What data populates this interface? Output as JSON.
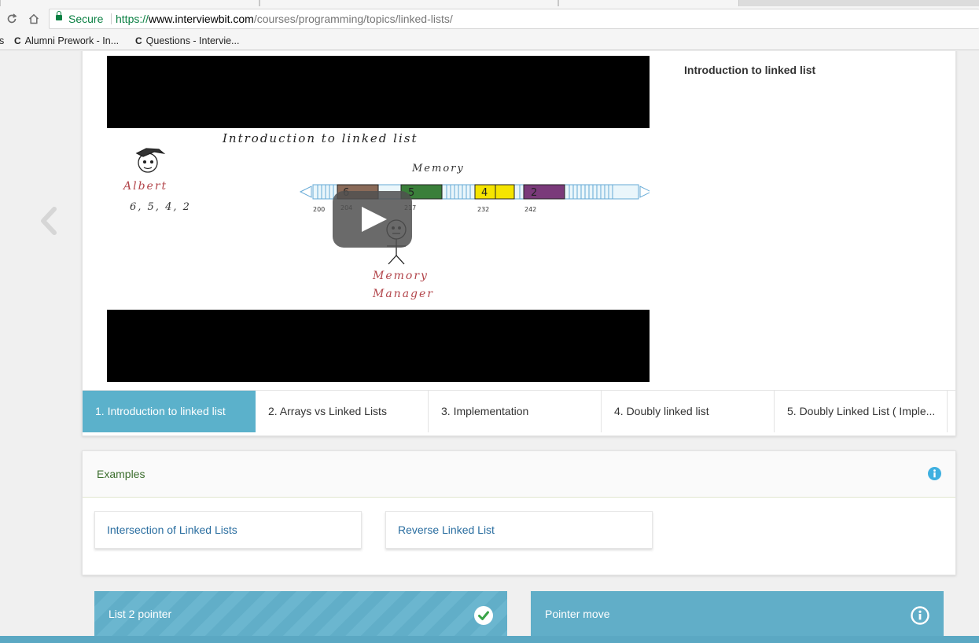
{
  "browser": {
    "secure_label": "Secure",
    "url_scheme": "https://",
    "url_host": "www.interviewbit.com",
    "url_path": "/courses/programming/topics/linked-lists/",
    "reload_icon": "reload-icon",
    "home_icon": "home-icon",
    "bookmarks": [
      {
        "label": "s",
        "icon": ""
      },
      {
        "label": "Alumni Prework - In...",
        "icon": "C"
      },
      {
        "label": "Questions - Intervie...",
        "icon": "C"
      }
    ]
  },
  "video": {
    "title": "Introduction to linked list",
    "frame": {
      "heading": "Introduction to linked list",
      "person_name": "Albert",
      "numbers": "6, 5, 4, 2",
      "memory_label": "Memory",
      "manager_label_1": "Memory",
      "manager_label_2": "Manager",
      "cells": [
        "6",
        "5",
        "4",
        "2"
      ],
      "addresses": [
        "200",
        "204",
        "217",
        "232",
        "242"
      ]
    }
  },
  "lesson_tabs": [
    {
      "label": "1. Introduction to linked list",
      "active": true
    },
    {
      "label": "2. Arrays vs Linked Lists",
      "active": false
    },
    {
      "label": "3. Implementation",
      "active": false
    },
    {
      "label": "4. Doubly linked list",
      "active": false
    },
    {
      "label": "5. Doubly Linked List ( Imple...",
      "active": false
    }
  ],
  "examples": {
    "title": "Examples",
    "items": [
      "Intersection of Linked Lists",
      "Reverse Linked List"
    ]
  },
  "problems": [
    {
      "title": "List 2 pointer",
      "status_icon": "check-circle-icon"
    },
    {
      "title": "Pointer move",
      "status_icon": "info-icon"
    }
  ],
  "colors": {
    "accent": "#5bb1cb",
    "card_blue": "#61aec8",
    "secure_green": "#0b8043",
    "link_blue": "#2a6ea0"
  }
}
